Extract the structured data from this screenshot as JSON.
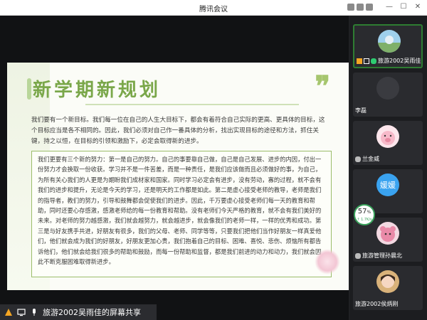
{
  "window": {
    "title": "腾讯会议"
  },
  "slide": {
    "title": "新学期新规划",
    "quote_glyph": "❞",
    "intro": "我们要有一个新目标。我们每一位在自己的人生大目标下，都会有着符合自己实际的更高、更具体的目标，这个目标应当是各不相同的。因此，我们必须对自己作一番具体的分析，找出实现目标的途径和方法，抓住关键，持之以恒，在目标的引领和激励下，必定会取得新的进步。",
    "box_text": "我们更要有三个新的努力：第一是自己的努力。自己的事要靠自己做，自己是自己发展、进步的内因，付出一份努力才会换取一份收获。学习并不是一件苦差，而是一种责任，是我们应该做而且必须做好的事，为自己，为所有关心我们的人更是为期盼我们成材家和国家。同时学习必定会有进步，没有劳动，寡的过程，就不会有我们的进步和提升，无论是今天的学习，还是明天的工作都是如此。第二是虚心接受老师的教导，老师是我们的指导者，教们的努力，引导和鼓舞都会促使我们的进步。因此，千万要虚心接受老师们每一天的教育和帮助，同时还要心存感激，感激老师给的每一份教育和帮助。没有老师们今天严格的教育，就不会有我们美好的未来。对老师的努力越感激，我们就会越努力，就会越进步，就会像我们的老师一样，一样的优秀和成功。第三是与好友携手共进，好朋友有很多，我们的父母、老师、同学等等，只要我们把他们当作好朋友一样真爱他们，他们就会成为我们的好朋友，好朋友更加心贵，我们抱着自己的目标、困难、喜悦、悲伤、烦恼所有都告诉他们，他们就会给我们很多的帮助和鼓励，而每一份帮助和监督，都是我们前进的动力和动力，我们就会因此不断克服困难取得新进步。"
  },
  "share": {
    "label": "旅游2002吴雨佳的屏幕共享"
  },
  "participants": [
    {
      "name": "旅游2002吴雨佳",
      "avatar": "landscape-avatar",
      "speaking": true
    },
    {
      "name": "李磊",
      "avatar": "blank-avatar",
      "speaking": false
    },
    {
      "name": "兰金威",
      "avatar": "pig-cartoon-avatar",
      "speaking": false
    },
    {
      "name": "媛媛",
      "avatar": "text-avatar",
      "speaking": false
    },
    {
      "name": "旅游管理孙晨北",
      "avatar": "bear-avatar",
      "speaking": false
    },
    {
      "name": "旅游2002侯炳刚",
      "avatar": "girl-avatar",
      "speaking": false
    }
  ],
  "network": {
    "percent": "57",
    "percent_unit": "%",
    "speed": "↑ 1.7K/s"
  },
  "colors": {
    "accent_green": "#7aa74a",
    "active_border": "#2e7d32",
    "text_avatar": "#3aa3f0"
  }
}
